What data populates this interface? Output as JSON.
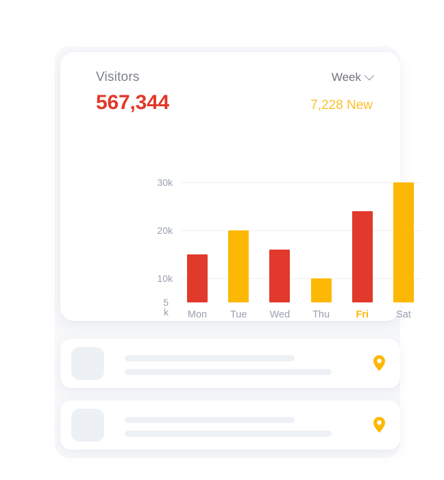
{
  "card": {
    "title": "Visitors",
    "total": "567,344",
    "range_label": "Week",
    "range_icon": "chevron-down-icon",
    "new_visitors": "7,228 New"
  },
  "colors": {
    "red": "#e1392b",
    "yellow": "#fdb806",
    "amber_text": "#fdc02e",
    "grid": "#eef0f4",
    "axis_text": "#9aa0b0",
    "skeleton": "#edf1f5"
  },
  "chart_data": {
    "type": "bar",
    "title": "Visitors",
    "xlabel": "",
    "ylabel": "",
    "categories": [
      "Mon",
      "Tue",
      "Wed",
      "Thu",
      "Fri",
      "Sat"
    ],
    "values": [
      15000,
      20000,
      16000,
      10000,
      24000,
      30000
    ],
    "colors": [
      "#e1392b",
      "#fdb806",
      "#e1392b",
      "#fdb806",
      "#e1392b",
      "#fdb806"
    ],
    "ytick_labels": [
      "30k",
      "20k",
      "10k",
      "5\nk"
    ],
    "ytick_values": [
      30000,
      20000,
      10000,
      5000
    ],
    "ylim": [
      5000,
      30000
    ],
    "grid": true,
    "legend": "none",
    "highlighted_category": "Fri"
  },
  "list": {
    "rows": [
      {
        "icon": "map-pin-icon"
      },
      {
        "icon": "map-pin-icon"
      }
    ]
  }
}
